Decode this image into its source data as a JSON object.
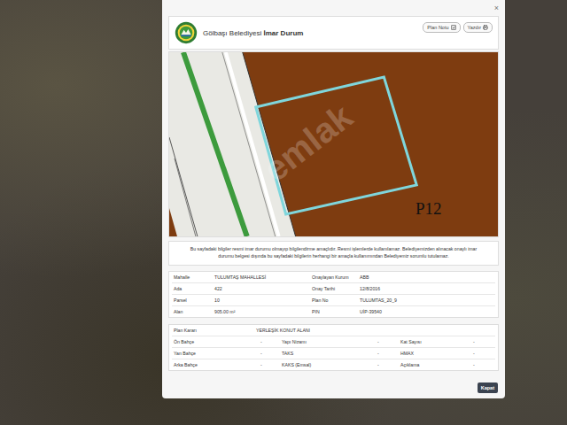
{
  "window": {
    "title_prefix": "Gölbaşı Belediyesi ",
    "title_bold": "İmar Durum",
    "close": "×"
  },
  "toolbar": [
    {
      "label": "Plan Notu",
      "kind": "note"
    },
    {
      "label": "Yazdır",
      "kind": "print"
    }
  ],
  "map": {
    "zone_label": "P12",
    "watermark": "emlak"
  },
  "notice": "Bu sayfadaki bilgiler resmi imar durumu olmayıp bilgilendirme amaçlıdır. Resmi işlemlerde kullanılamaz. Belediyemizden alınacak onaylı imar durumu belgesi dışında bu sayfadaki bilgilerin herhangi bir amaçla kullanımından Belediyemiz sorumlu tutulamaz.",
  "info": [
    {
      "label": "Mahalle",
      "value": "TULUMTAŞ MAHALLESİ",
      "label2": "Onaylayan Kurum",
      "value2": "ABB"
    },
    {
      "label": "Ada",
      "value": "422",
      "label2": "Onay Tarihi",
      "value2": "12/8/2016"
    },
    {
      "label": "Parsel",
      "value": "10",
      "label2": "Plan No",
      "value2": "TULUMTAS_20_9"
    },
    {
      "label": "Alan",
      "value": "905.00 m²",
      "label2": "PIN",
      "value2": "UİP-39540"
    }
  ],
  "plan": {
    "decision_label": "Plan Kararı",
    "decision_value": "YERLEŞİK KONUT ALANI",
    "rows": [
      [
        {
          "label": "Ön Bahçe",
          "value": "-"
        },
        {
          "label": "Yapı Nizamı",
          "value": "-"
        },
        {
          "label": "Kat Sayısı",
          "value": "-"
        }
      ],
      [
        {
          "label": "Yan Bahçe",
          "value": "-"
        },
        {
          "label": "TAKS",
          "value": "-"
        },
        {
          "label": "HMAX",
          "value": "-"
        }
      ],
      [
        {
          "label": "Arka Bahçe",
          "value": "-"
        },
        {
          "label": "KAKS (Emsal)",
          "value": "-"
        },
        {
          "label": "Açıklama",
          "value": "-"
        }
      ]
    ]
  },
  "buttons": [
    "Kapat"
  ]
}
